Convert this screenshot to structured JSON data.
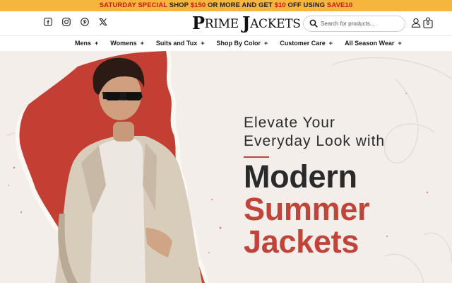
{
  "promo": {
    "part1": "SATURDAY SPECIAL",
    "part2": " SHOP ",
    "part3": "$150",
    "part4": " OR MORE AND GET ",
    "part5": "$10",
    "part6": " OFF USING ",
    "part7": "SAVE10"
  },
  "header": {
    "logo_part1": "P",
    "logo_part2": "RIME ",
    "logo_part3": "J",
    "logo_part4": "ACKETS",
    "search_placeholder": "Search for products...",
    "cart_count": "0"
  },
  "social_icons": [
    "facebook-icon",
    "instagram-icon",
    "pinterest-icon",
    "x-icon"
  ],
  "nav": {
    "items": [
      {
        "label": "Mens",
        "suffix": "+"
      },
      {
        "label": "Womens",
        "suffix": "+"
      },
      {
        "label": "Suits and Tux",
        "suffix": "+"
      },
      {
        "label": "Shop By Color",
        "suffix": "+"
      },
      {
        "label": "Customer Care",
        "suffix": "+"
      },
      {
        "label": "All Season Wear",
        "suffix": "+"
      }
    ]
  },
  "hero": {
    "line1": "Elevate Your",
    "line2": "Everyday Look with",
    "line3": "Modern",
    "line4": "Summer",
    "line5": "Jackets"
  },
  "colors": {
    "promo_bg": "#f6b63e",
    "promo_red": "#d01717",
    "accent": "#c0443a",
    "hero_bg": "#f3eee9"
  }
}
